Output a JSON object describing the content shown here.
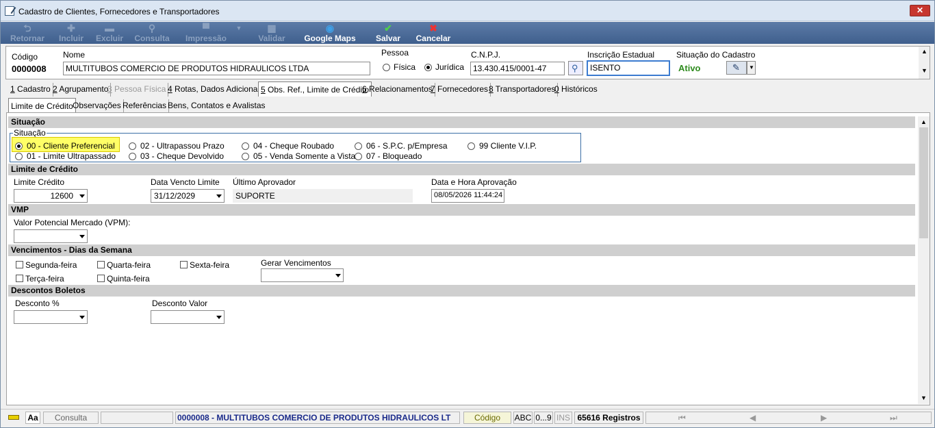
{
  "window": {
    "title": "Cadastro de Clientes, Fornecedores e Transportadores",
    "close_label": "✕"
  },
  "toolbar": {
    "retornar": "Retornar",
    "incluir": "Incluir",
    "excluir": "Excluir",
    "consulta": "Consulta",
    "impressao": "Impressão",
    "validar": "Validar",
    "google_maps": "Google Maps",
    "salvar": "Salvar",
    "cancelar": "Cancelar"
  },
  "header": {
    "codigo_label": "Código",
    "codigo_value": "0000008",
    "nome_label": "Nome",
    "nome_value": "MULTITUBOS COMERCIO DE PRODUTOS HIDRAULICOS LTDA",
    "pessoa_label": "Pessoa",
    "pessoa_fisica": "Física",
    "pessoa_juridica": "Jurídica",
    "cnpj_label": "C.N.P.J.",
    "cnpj_value": "13.430.415/0001-47",
    "ie_label": "Inscrição Estadual",
    "ie_value": "ISENTO",
    "situacao_label": "Situação do Cadastro",
    "situacao_value": "Ativo",
    "situacao_color": "#2e8b1e"
  },
  "tabs": [
    {
      "n": "1",
      "label": " Cadastro"
    },
    {
      "n": "2",
      "label": " Agrupamento"
    },
    {
      "n": "3",
      "label": " Pessoa Física"
    },
    {
      "n": "4",
      "label": " Rotas, Dados Adicionais"
    },
    {
      "n": "5",
      "label": " Obs. Ref., Limite de Crédito"
    },
    {
      "n": "6",
      "label": " Relacionamentos"
    },
    {
      "n": "7",
      "label": " Fornecedores"
    },
    {
      "n": "8",
      "label": " Transportadores"
    },
    {
      "n": "0",
      "label": " Históricos"
    }
  ],
  "subtabs": [
    "Limite de Crédito",
    "Observações",
    "Referências",
    "Bens, Contatos e Avalistas"
  ],
  "situacao": {
    "section": "Situação",
    "group": "Situação",
    "options": [
      "00 - Cliente Preferencial",
      "01 - Limite Ultrapassado",
      "02 - Ultrapassou Prazo",
      "03 - Cheque Devolvido",
      "04 - Cheque Roubado",
      "05 - Venda Somente a Vista",
      "06 - S.P.C. p/Empresa",
      "07 - Bloqueado",
      "99 Cliente V.I.P."
    ],
    "selected": "00 - Cliente Preferencial"
  },
  "limite": {
    "section": "Limite de Crédito",
    "limite_label": "Limite Crédito",
    "limite_value": "12600",
    "data_label": "Data Vencto Limite",
    "data_value": "31/12/2029",
    "aprovador_label": "Último Aprovador",
    "aprovador_value": "SUPORTE",
    "dh_label": "Data e Hora Aprovação",
    "dh_value": "08/05/2026 11:44:24"
  },
  "vmp": {
    "section": "VMP",
    "label": "Valor Potencial Mercado (VPM):"
  },
  "vencimentos": {
    "section": "Vencimentos - Dias da Semana",
    "dias": [
      "Segunda-feira",
      "Terça-feira",
      "Quarta-feira",
      "Quinta-feira",
      "Sexta-feira"
    ],
    "gerar_label": "Gerar Vencimentos"
  },
  "descontos": {
    "section": "Descontos Boletos",
    "pct_label": "Desconto %",
    "valor_label": "Desconto Valor"
  },
  "status": {
    "aa": "Aa",
    "mode": "Consulta",
    "record": "0000008 - MULTITUBOS COMERCIO DE PRODUTOS HIDRAULICOS LT",
    "field": "Código",
    "abc": "ABC",
    "num": "0...9",
    "ins": "INS",
    "count": "65616 Registros"
  }
}
